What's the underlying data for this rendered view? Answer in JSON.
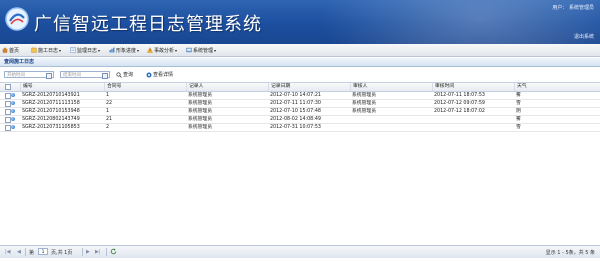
{
  "header": {
    "title": "广信智远工程日志管理系统",
    "user_label": "用户：",
    "user_name": "系统管理员",
    "logout": "退出系统"
  },
  "menu": [
    {
      "label": "首页",
      "icon": "home-icon"
    },
    {
      "label": "施工日志",
      "icon": "construction-log-icon"
    },
    {
      "label": "监理日志",
      "icon": "supervision-log-icon"
    },
    {
      "label": "形象进度",
      "icon": "progress-icon"
    },
    {
      "label": "事故分析",
      "icon": "accident-analysis-icon"
    },
    {
      "label": "系统管理",
      "icon": "system-admin-icon"
    }
  ],
  "panel": {
    "title": "查阅施工日志"
  },
  "toolbar": {
    "start_placeholder": "开始时间",
    "end_placeholder": "结束时间",
    "search_label": "查询",
    "detail_label": "查看详情"
  },
  "table": {
    "columns": [
      "编号",
      "合同号",
      "记录人",
      "记录日期",
      "审核人",
      "审核时间",
      "天气"
    ],
    "rows": [
      [
        "SGRZ-20120710143921",
        "1",
        "系统管理员",
        "2012-07-10 14:07:21",
        "系统管理员",
        "2012-07-11 18:07:53",
        "雾"
      ],
      [
        "SGRZ-20120711113158",
        "22",
        "系统管理员",
        "2012-07-11 11:07:30",
        "系统管理员",
        "2012-07-12 09:07:59",
        "雪"
      ],
      [
        "SGRZ-20120710153948",
        "1",
        "系统管理员",
        "2012-07-10 15:07:48",
        "系统管理员",
        "2012-07-12 18:07:02",
        "阴"
      ],
      [
        "SGRZ-20120802143749",
        "21",
        "系统管理员",
        "2012-08-02 14:08:49",
        "",
        "",
        "雾"
      ],
      [
        "SGRZ-20120731105853",
        "2",
        "系统管理员",
        "2012-07-31 10:07:53",
        "",
        "",
        "雪"
      ]
    ]
  },
  "pager": {
    "page_prefix": "第",
    "current_page": "1",
    "page_suffix": "页,共 1页",
    "summary": "显示 1 - 5条，共 5 条"
  },
  "colors": {
    "header": "#1f55a5",
    "accent": "#15428b"
  }
}
